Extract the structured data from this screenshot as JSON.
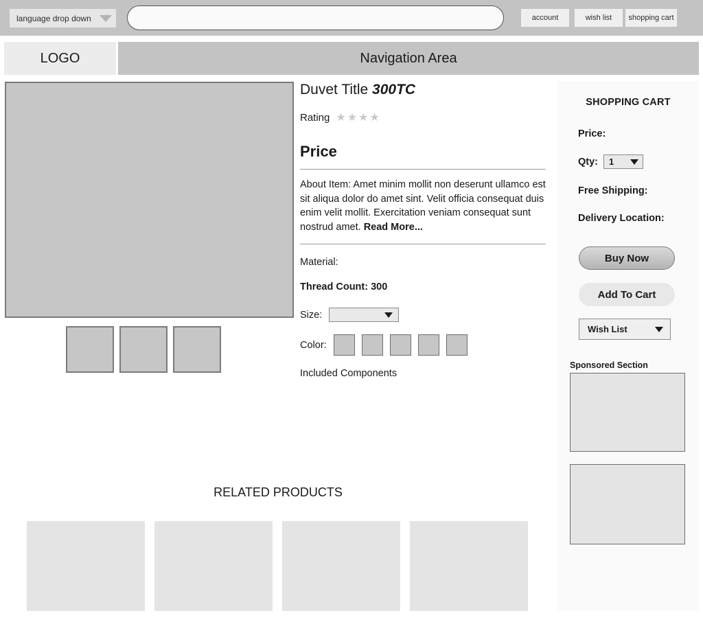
{
  "topbar": {
    "language_dropdown": {
      "label": "language drop down",
      "icon": "chevron-down-icon"
    },
    "search": {
      "value": "",
      "placeholder": ""
    },
    "buttons": [
      {
        "name": "account",
        "label": "account"
      },
      {
        "name": "wish-list",
        "label": "wish list"
      },
      {
        "name": "shopping-cart",
        "label": "shopping cart"
      }
    ]
  },
  "header": {
    "logo": "LOGO",
    "nav_area": "Navigation Area"
  },
  "gallery": {
    "main_image_alt": "product-main-image",
    "thumbnails": [
      "thumbnail-1",
      "thumbnail-2",
      "thumbnail-3"
    ]
  },
  "detail": {
    "title_prefix": "Duvet Title ",
    "title_emphasis": "300TC",
    "rating_label": "Rating",
    "rating_stars": "★★★★",
    "rating_value": 4,
    "price_heading": "Price",
    "about_text": "About Item: Amet minim mollit non deserunt ullamco est sit aliqua dolor do amet sint. Velit officia consequat duis enim velit mollit. Exercitation veniam consequat sunt nostrud amet. ",
    "read_more": "Read More...",
    "material_label": "Material:",
    "thread_count": "Thread Count: 300",
    "size_label": "Size:",
    "size_value": "",
    "size_caret": "caret-down-icon",
    "color_label": "Color:",
    "color_swatches": [
      "swatch-1",
      "swatch-2",
      "swatch-3",
      "swatch-4",
      "swatch-5"
    ],
    "included_components": "Included Components"
  },
  "sidebar": {
    "heading": "SHOPPING CART",
    "price_label": "Price:",
    "qty_label": "Qty:",
    "qty_value": "1",
    "qty_caret": "caret-down-icon",
    "free_shipping_label": "Free Shipping:",
    "delivery_location_label": "Delivery Location:",
    "buy_now_label": "Buy Now",
    "add_to_cart_label": "Add To Cart",
    "wish_list_label": "Wish List",
    "wish_list_caret": "caret-down-icon",
    "sponsored_heading": "Sponsored Section",
    "ads": [
      "sponsored-ad-1",
      "sponsored-ad-2"
    ]
  },
  "related": {
    "heading": "RELATED PRODUCTS",
    "cards": [
      "related-product-1",
      "related-product-2",
      "related-product-3",
      "related-product-4"
    ]
  },
  "colors": {
    "topbar_bg": "#c3c3c3",
    "nav_bg": "#c3c3c3",
    "logo_bg": "#ececec",
    "placeholder_gray": "#c6c6c6",
    "panel_bg": "#fafafa",
    "ad_gray": "#e4e4e4",
    "star_gray": "#c9c9c9"
  }
}
